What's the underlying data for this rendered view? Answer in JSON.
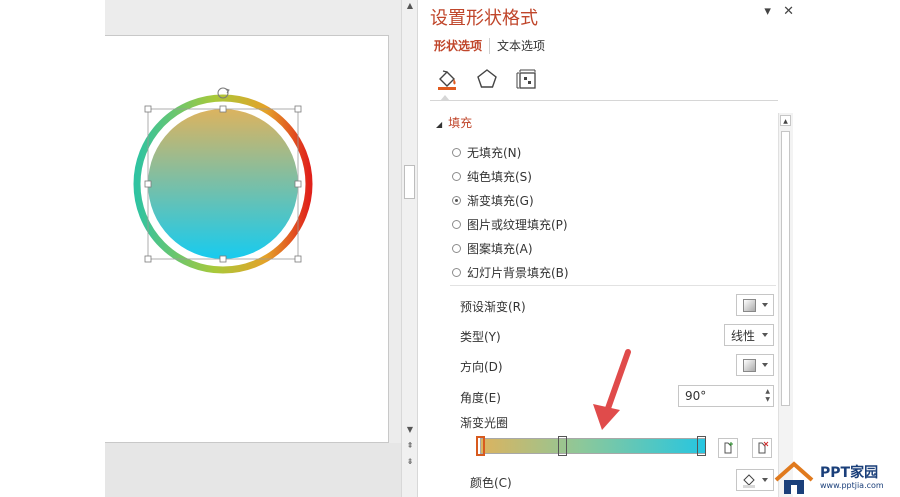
{
  "panel": {
    "title": "设置形状格式",
    "tabs": [
      {
        "label": "形状选项",
        "active": true
      },
      {
        "label": "文本选项",
        "active": false
      }
    ],
    "icons": [
      "fill-bucket-icon",
      "pentagon-icon",
      "size-properties-icon"
    ],
    "section": {
      "title": "填充",
      "options": [
        {
          "label": "无填充(N)",
          "checked": false
        },
        {
          "label": "纯色填充(S)",
          "checked": false
        },
        {
          "label": "渐变填充(G)",
          "checked": true
        },
        {
          "label": "图片或纹理填充(P)",
          "checked": false
        },
        {
          "label": "图案填充(A)",
          "checked": false
        },
        {
          "label": "幻灯片背景填充(B)",
          "checked": false
        }
      ]
    },
    "gradient": {
      "preset_label": "预设渐变(R)",
      "type_label": "类型(Y)",
      "type_value": "线性",
      "direction_label": "方向(D)",
      "angle_label": "角度(E)",
      "angle_value": "90°",
      "stops_label": "渐变光圈",
      "stop_positions": [
        0,
        0.38,
        1
      ],
      "color_label": "颜色(C)"
    }
  },
  "colors": {
    "accent": "#c0462b",
    "gradient_start": "#dcb35f",
    "gradient_end": "#26c6e1",
    "arrow": "#e04b4b"
  },
  "watermark": {
    "brand": "PPT家园",
    "url": "www.pptjia.com"
  }
}
